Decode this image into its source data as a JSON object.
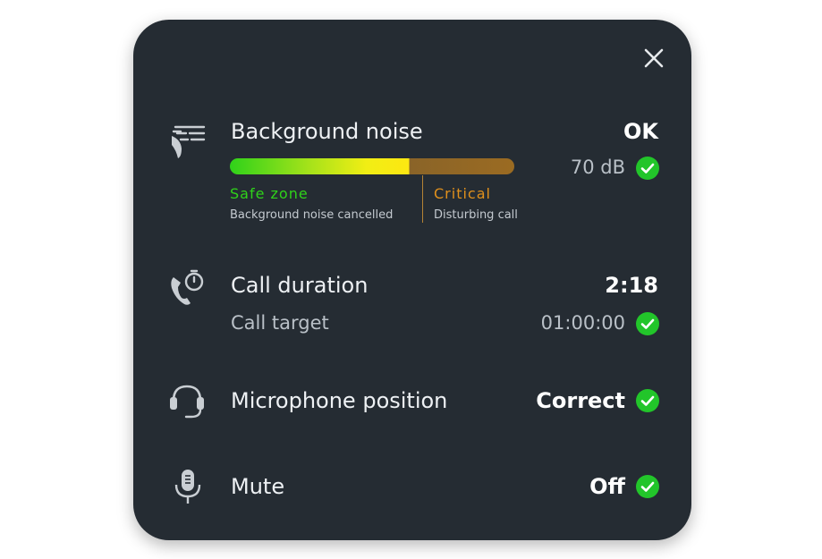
{
  "noise": {
    "title": "Background noise",
    "status": "OK",
    "level": "70 dB",
    "bar_fill_percent": 63,
    "safe_label": "Safe zone",
    "safe_desc": "Background noise cancelled",
    "critical_label": "Critical",
    "critical_desc": "Disturbing call"
  },
  "call": {
    "title": "Call duration",
    "value": "2:18",
    "target_label": "Call target",
    "target_value": "01:00:00"
  },
  "mic": {
    "title": "Microphone position",
    "value": "Correct"
  },
  "mute": {
    "title": "Mute",
    "value": "Off"
  },
  "colors": {
    "panel": "#252c33",
    "ok_green": "#22c52a",
    "safe_green": "#2fd21a",
    "critical_orange": "#e0901c"
  },
  "icons": [
    "close-icon",
    "noise-icon",
    "call-timer-icon",
    "headset-icon",
    "microphone-icon",
    "check-icon"
  ]
}
